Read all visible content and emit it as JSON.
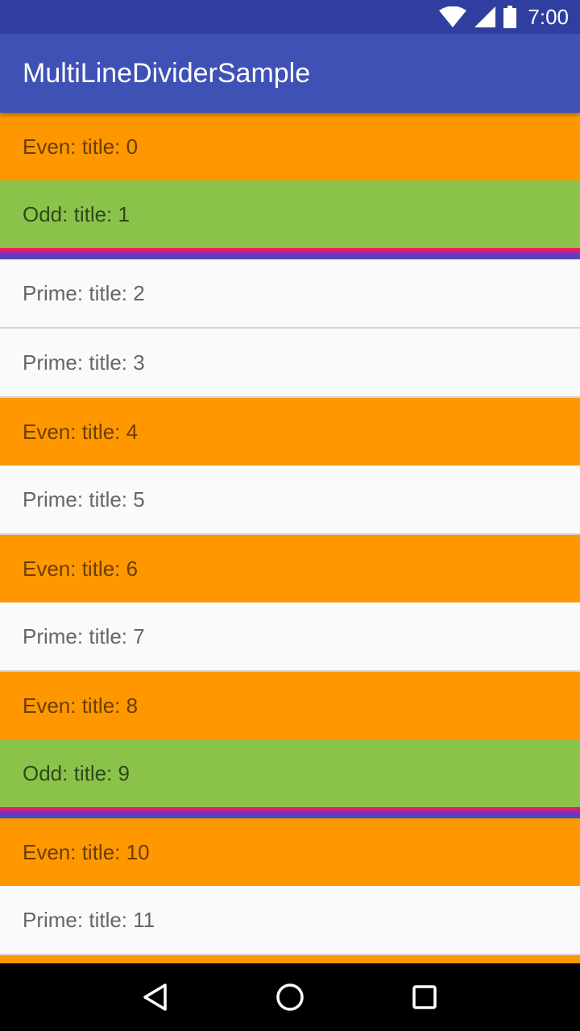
{
  "status_bar": {
    "time": "7:00",
    "icons": [
      "wifi-icon",
      "cell-signal-icon",
      "battery-icon"
    ],
    "color": "#303f9f"
  },
  "app_bar": {
    "title": "MultiLineDividerSample",
    "color": "#3f51b5"
  },
  "colors": {
    "even": "#ff9800",
    "odd": "#8bc34a",
    "prime": "#fafafa",
    "multi_divider": [
      "#e91e63",
      "#9c27b0",
      "#673ab7",
      "#3f51b5"
    ]
  },
  "list": {
    "items": [
      {
        "label": "Even: title: 0",
        "kind": "even"
      },
      {
        "label": "Odd: title: 1",
        "kind": "odd"
      },
      {
        "label": "Prime: title: 2",
        "kind": "prime"
      },
      {
        "label": "Prime: title: 3",
        "kind": "prime"
      },
      {
        "label": "Even: title: 4",
        "kind": "even"
      },
      {
        "label": "Prime: title: 5",
        "kind": "prime"
      },
      {
        "label": "Even: title: 6",
        "kind": "even"
      },
      {
        "label": "Prime: title: 7",
        "kind": "prime"
      },
      {
        "label": "Even: title: 8",
        "kind": "even"
      },
      {
        "label": "Odd: title: 9",
        "kind": "odd"
      },
      {
        "label": "Even: title: 10",
        "kind": "even"
      },
      {
        "label": "Prime: title: 11",
        "kind": "prime"
      },
      {
        "label": "",
        "kind": "even"
      }
    ]
  },
  "nav_bar": {
    "buttons": [
      "back-icon",
      "home-icon",
      "recents-icon"
    ]
  }
}
